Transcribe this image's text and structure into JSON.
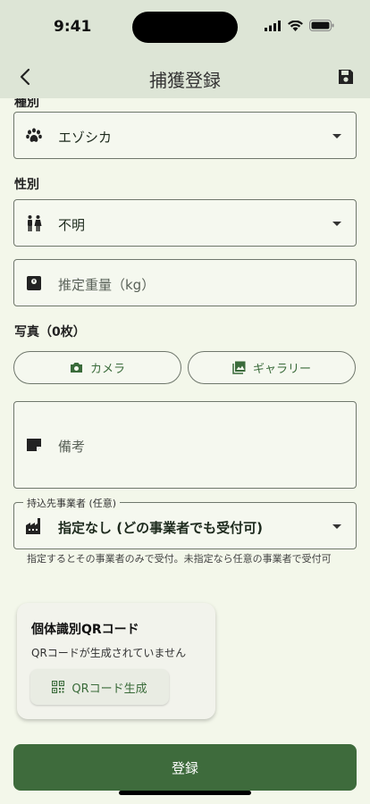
{
  "status_bar": {
    "time": "9:41"
  },
  "app_bar": {
    "title": "捕獲登録"
  },
  "form": {
    "species_label_partial": "種別",
    "species_value": "エゾシカ",
    "sex_label": "性別",
    "sex_value": "不明",
    "weight_placeholder": "推定重量（kg）",
    "photo_label": "写真（0枚）",
    "camera_label": "カメラ",
    "gallery_label": "ギャラリー",
    "notes_placeholder": "備考",
    "operator_label": "持込先事業者 (任意)",
    "operator_value": "指定なし (どの事業者でも受付可)",
    "operator_helper": "指定するとその事業者のみで受付。未指定なら任意の事業者で受付可"
  },
  "qr_card": {
    "title": "個体識別QRコード",
    "status": "QRコードが生成されていません",
    "button_label": "QRコード生成"
  },
  "submit_label": "登録",
  "colors": {
    "primary": "#3e6b3c",
    "background": "#f3f7ea",
    "appbar": "#dde5d6"
  },
  "icons": [
    "back-arrow-icon",
    "save-icon",
    "paw-icon",
    "people-icon",
    "scale-icon",
    "camera-icon",
    "gallery-icon",
    "note-icon",
    "factory-icon",
    "qr-icon"
  ]
}
